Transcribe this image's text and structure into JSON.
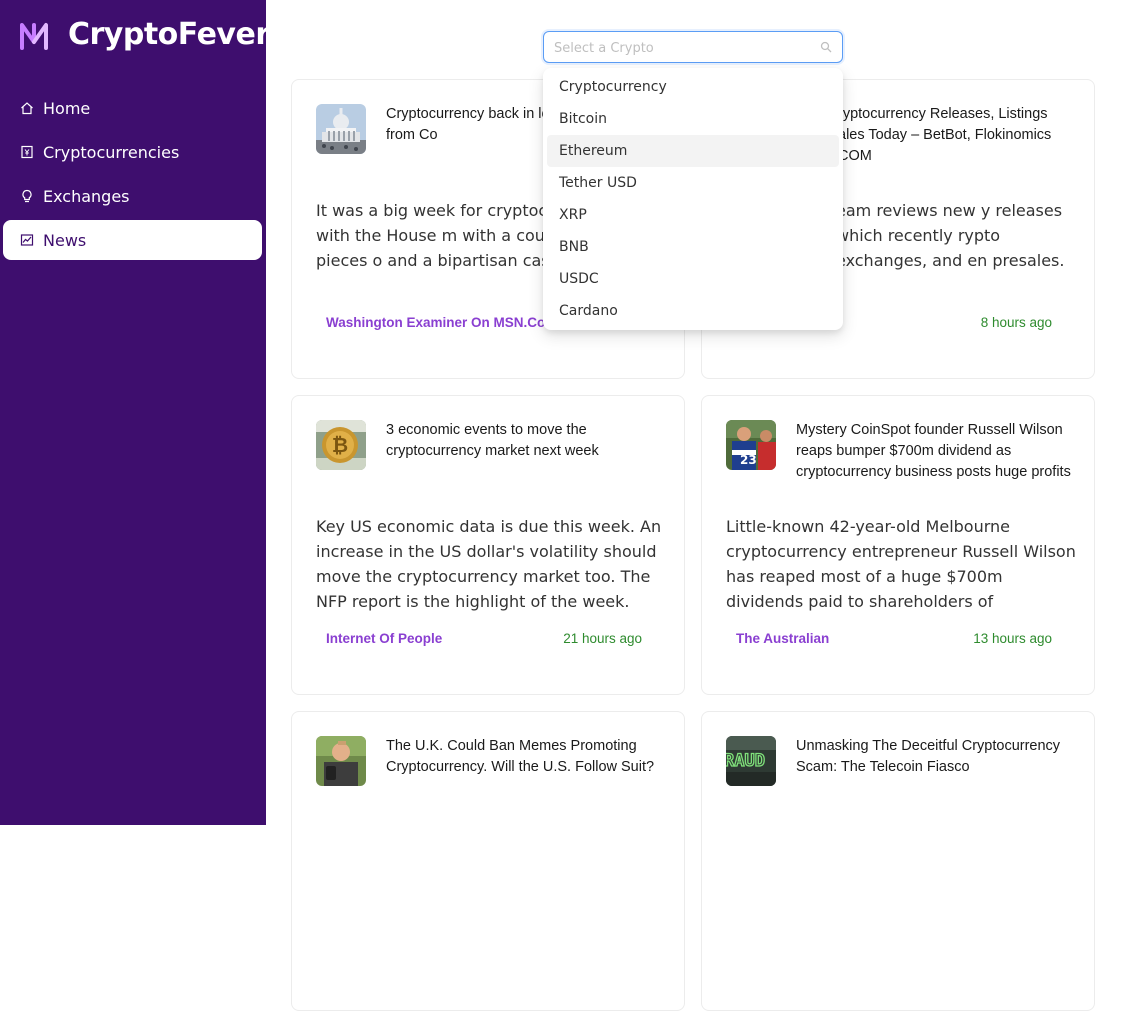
{
  "brand": {
    "name": "CryptoFever",
    "logo_icon": "crypto-logo-icon"
  },
  "sidebar": {
    "items": [
      {
        "label": "Home",
        "icon": "home-icon",
        "active": false
      },
      {
        "label": "Cryptocurrencies",
        "icon": "money-collect-icon",
        "active": false
      },
      {
        "label": "Exchanges",
        "icon": "bulb-icon",
        "active": false
      },
      {
        "label": "News",
        "icon": "fund-icon",
        "active": true
      }
    ]
  },
  "search": {
    "placeholder": "Select a Crypto",
    "value": ""
  },
  "dropdown": {
    "options": [
      "Cryptocurrency",
      "Bitcoin",
      "Ethereum",
      "Tether USD",
      "XRP",
      "BNB",
      "USDC",
      "Cardano"
    ],
    "highlighted": "Ethereum"
  },
  "news": [
    {
      "title": "Cryptocurrency back in legislative push from Co",
      "description": "It was a big week for cryptoc Capitol Hill, with the House m with a couple major pieces o and a bipartisan caste of ser",
      "source": "Washington Examiner On MSN.Co",
      "time": "",
      "thumb": "capitol-thumbnail"
    },
    {
      "title": "ryptocurrency Releases, Listings ales Today – BetBot, Flokinomics COM",
      "description": "eam reviews new y releases which recently rypto exchanges, and en presales.",
      "source": "",
      "time": "8 hours ago",
      "thumb": ""
    },
    {
      "title": "3 economic events to move the cryptocurrency market next week",
      "description": "Key US economic data is due this week. An increase in the US dollar's volatility should move the cryptocurrency market too. The NFP report is the highlight of the week.",
      "source": "Internet Of People",
      "time": "21 hours ago",
      "thumb": "bitcoin-coin-thumbnail"
    },
    {
      "title": "Mystery CoinSpot founder Russell Wilson reaps bumper $700m dividend as cryptocurrency business posts huge profits",
      "description": "Little-known 42-year-old Melbourne cryptocurrency entrepreneur Russell Wilson has reaped most of a huge $700m dividends paid to shareholders of",
      "source": "The Australian",
      "time": "13 hours ago",
      "thumb": "footballer-thumbnail"
    },
    {
      "title": "The U.K. Could Ban Memes Promoting Cryptocurrency. Will the U.S. Follow Suit?",
      "description": "",
      "source": "",
      "time": "",
      "thumb": "person-phone-thumbnail"
    },
    {
      "title": "Unmasking The Deceitful Cryptocurrency Scam: The Telecoin Fiasco",
      "description": "",
      "source": "",
      "time": "",
      "thumb": "fraud-sign-thumbnail"
    }
  ],
  "colors": {
    "sidebar": "#3e0e6e",
    "accent": "#8a3fd1",
    "time": "#2e8b2e",
    "search_border": "#5b9df5"
  }
}
